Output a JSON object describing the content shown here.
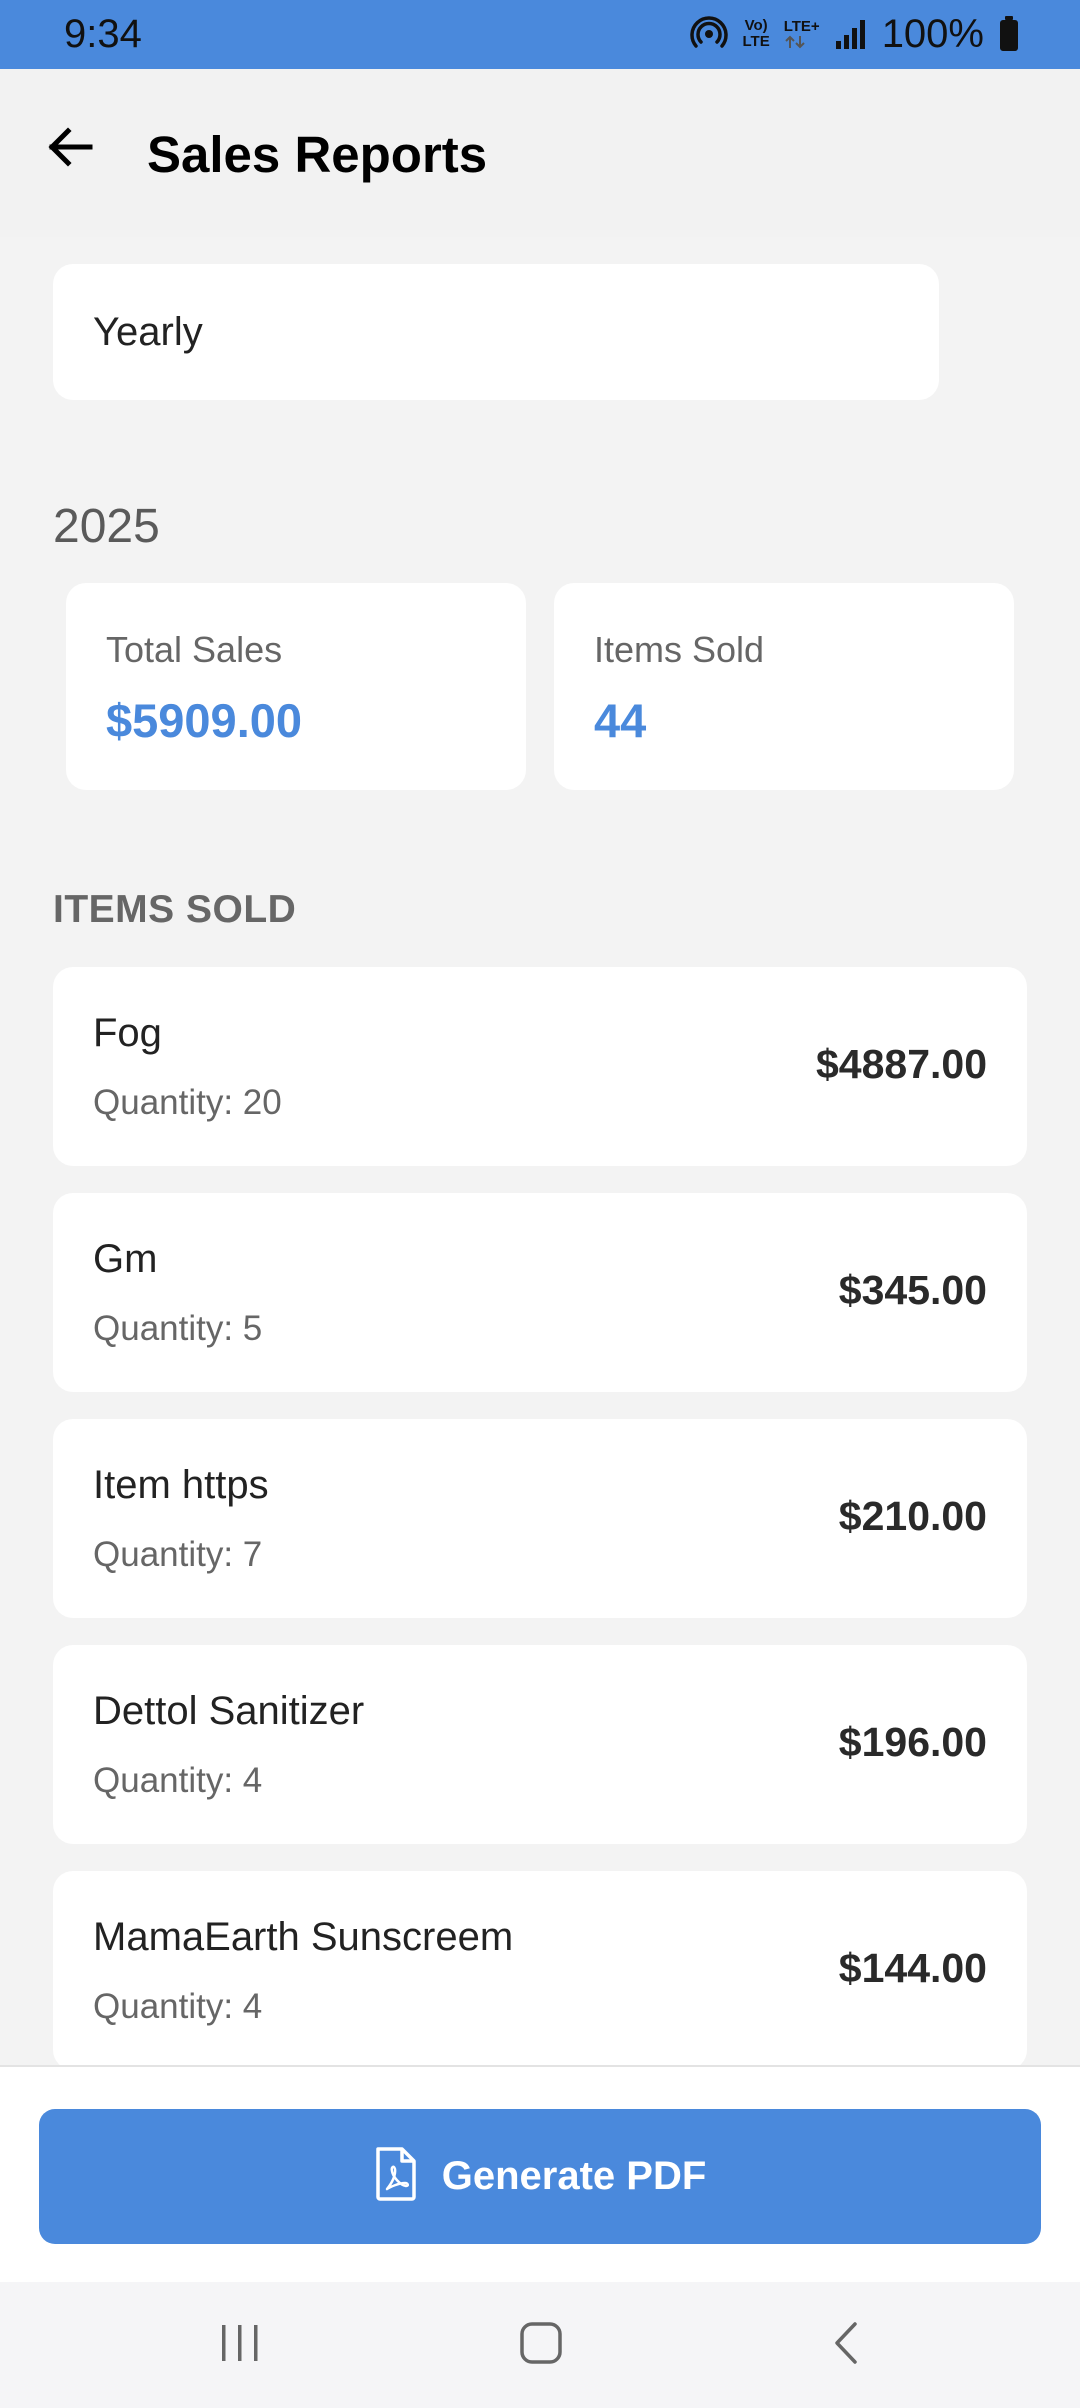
{
  "status_bar": {
    "time": "9:34",
    "battery": "100%",
    "network_top": "Vo)",
    "network_bottom": "LTE",
    "lte_plus": "LTE+",
    "icons": [
      "hotspot-icon",
      "volte-icon",
      "lte-plus-icon",
      "signal-icon",
      "battery-icon"
    ]
  },
  "app_bar": {
    "title": "Sales Reports",
    "back_icon": "arrow-left-icon"
  },
  "period": {
    "value": "Yearly"
  },
  "year": "2025",
  "stats": {
    "total_sales_label": "Total Sales",
    "total_sales_value": "$5909.00",
    "items_sold_label": "Items Sold",
    "items_sold_value": "44"
  },
  "items_section": {
    "title": "ITEMS SOLD",
    "items": [
      {
        "name": "Fog",
        "quantity": "Quantity: 20",
        "price": "$4887.00"
      },
      {
        "name": "Gm",
        "quantity": "Quantity: 5",
        "price": "$345.00"
      },
      {
        "name": "Item https",
        "quantity": "Quantity: 7",
        "price": "$210.00"
      },
      {
        "name": "Dettol Sanitizer",
        "quantity": "Quantity: 4",
        "price": "$196.00"
      },
      {
        "name": "MamaEarth Sunscreem",
        "quantity": "Quantity: 4",
        "price": "$144.00"
      }
    ]
  },
  "actions": {
    "generate_pdf_label": "Generate PDF",
    "generate_pdf_icon": "pdf-file-icon"
  },
  "nav_bar": {
    "icons": [
      "recent-apps-icon",
      "home-icon",
      "back-icon"
    ]
  },
  "colors": {
    "accent": "#4a89dc",
    "background": "#f3f3f3",
    "card": "#ffffff"
  }
}
